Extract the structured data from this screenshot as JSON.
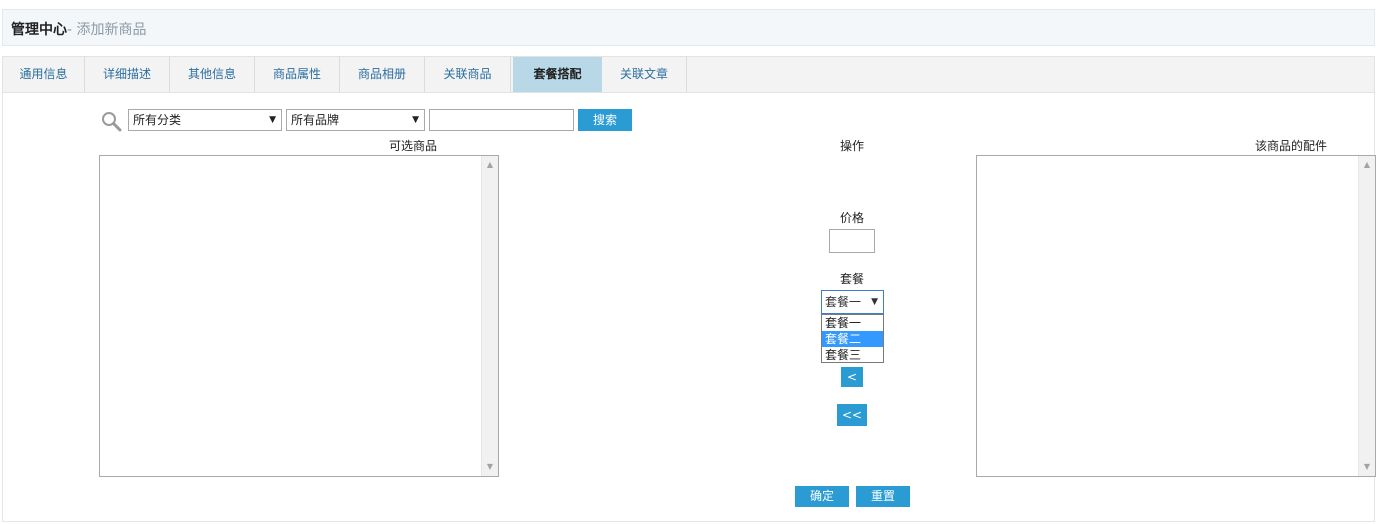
{
  "header": {
    "title": "管理中心",
    "subtitle": "- 添加新商品"
  },
  "tabs": [
    {
      "label": "通用信息",
      "active": false
    },
    {
      "label": "详细描述",
      "active": false
    },
    {
      "label": "其他信息",
      "active": false
    },
    {
      "label": "商品属性",
      "active": false
    },
    {
      "label": "商品相册",
      "active": false
    },
    {
      "label": "关联商品",
      "active": false
    },
    {
      "label": "套餐搭配",
      "active": true
    },
    {
      "label": "关联文章",
      "active": false
    }
  ],
  "search": {
    "icon": "search-icon",
    "category_select": "所有分类",
    "brand_select": "所有品牌",
    "keyword_value": "",
    "button_label": "搜索"
  },
  "columns": {
    "available": "可选商品",
    "operation": "操作",
    "accessories": "该商品的配件"
  },
  "operation": {
    "price_label": "价格",
    "price_value": "",
    "package_label": "套餐",
    "package_selected": "套餐一",
    "package_options": [
      "套餐一",
      "套餐二",
      "套餐三"
    ],
    "highlighted_option": "套餐二",
    "remove_one": "<",
    "remove_all": "<<"
  },
  "footer": {
    "confirm": "确定",
    "reset": "重置"
  },
  "colors": {
    "accent": "#2b9bd3",
    "active_tab": "#b8d8e8",
    "header_bg": "#f3f7fa",
    "highlight": "#3399ff"
  }
}
